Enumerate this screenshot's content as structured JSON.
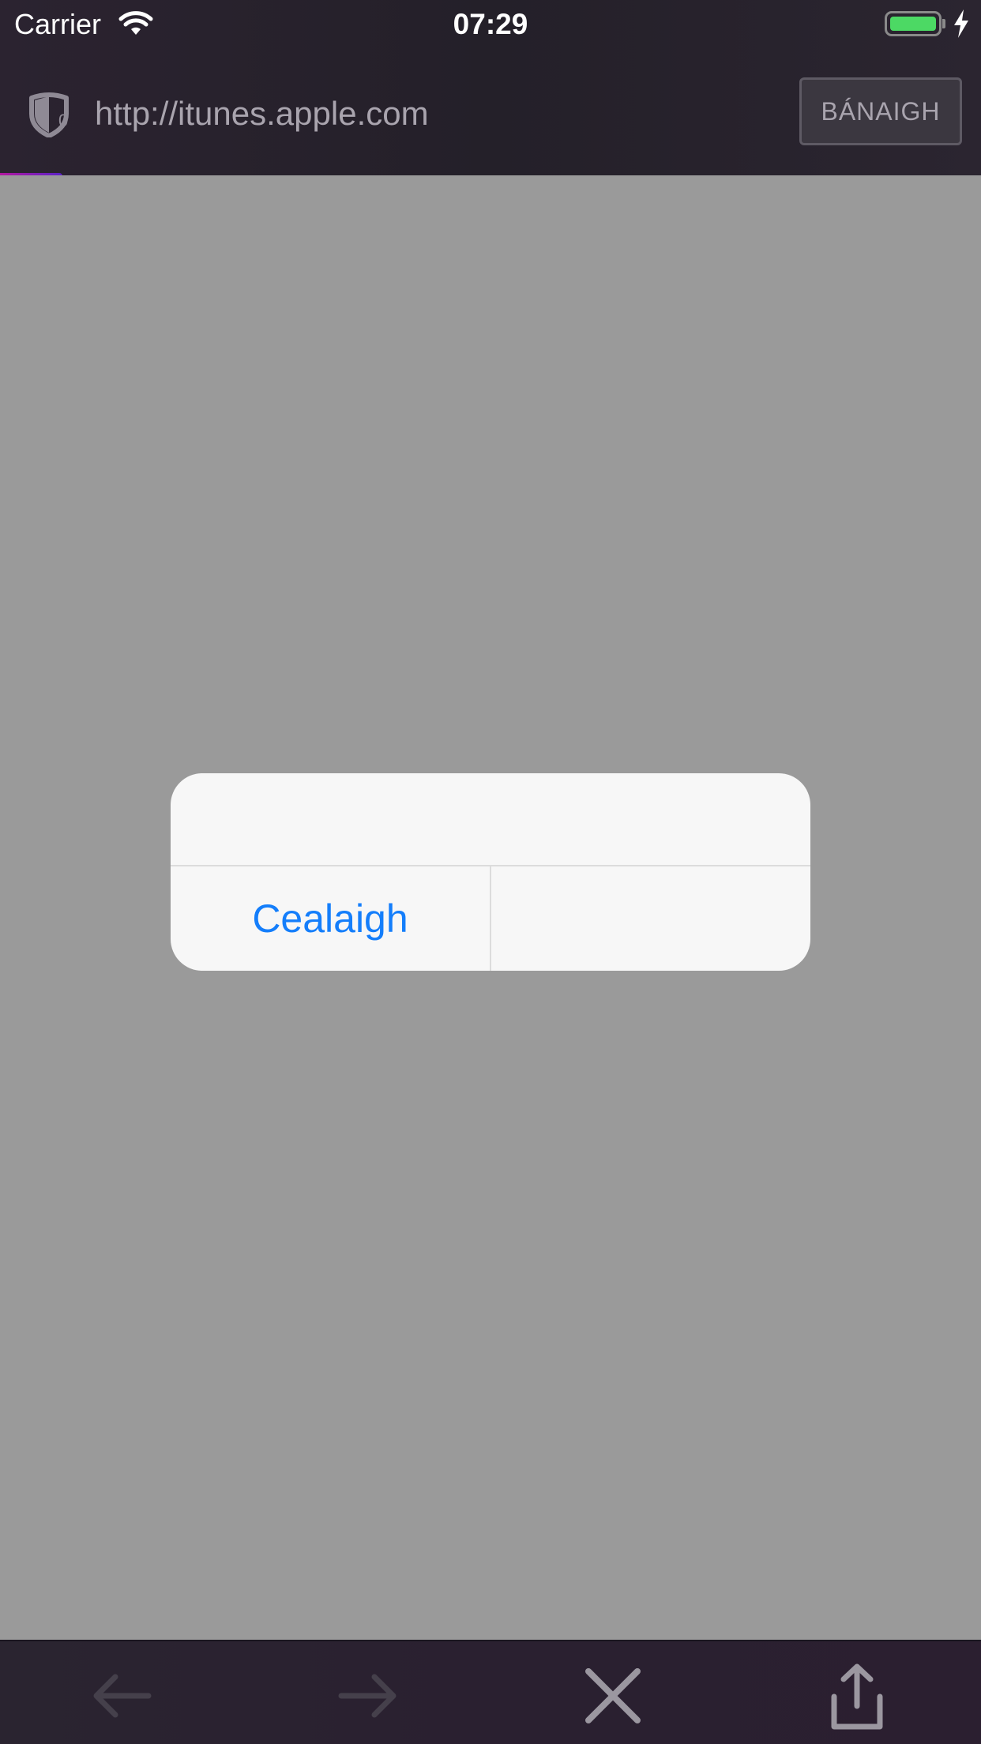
{
  "status_bar": {
    "carrier": "Carrier",
    "time": "07:29",
    "battery_color": "#4cd964"
  },
  "url_bar": {
    "shield_icon": "shield-icon",
    "blocked_count": "0",
    "url": "http://itunes.apple.com",
    "close_label": "BÁNAIGH",
    "progress": 0.064,
    "progress_colors": [
      "#b3179f",
      "#5b22c9"
    ]
  },
  "dialog": {
    "left_button": "Cealaigh",
    "right_button": "",
    "button_color": "#147efb"
  },
  "toolbar": {
    "back_icon": "arrow-left-icon",
    "forward_icon": "arrow-right-icon",
    "stop_icon": "close-icon",
    "share_icon": "share-icon"
  }
}
